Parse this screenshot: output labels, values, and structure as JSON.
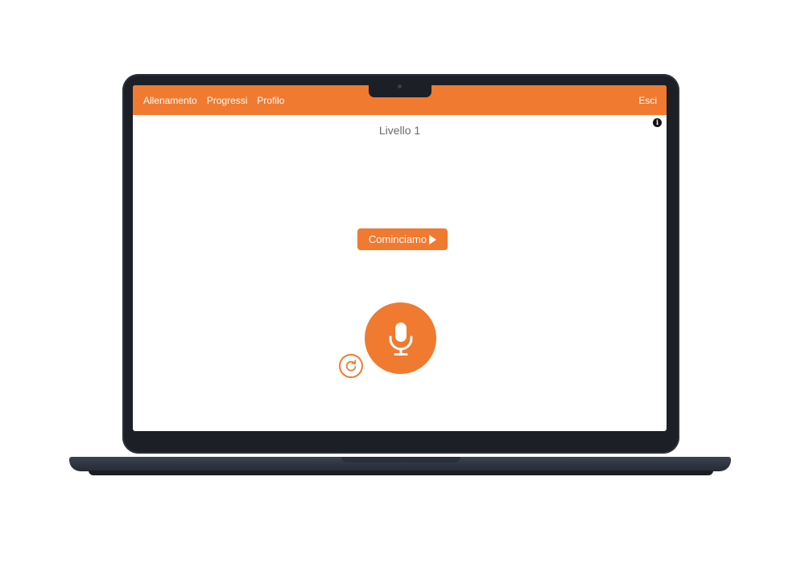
{
  "nav": {
    "links": [
      "Allenamento",
      "Progressi",
      "Profilo"
    ],
    "logout_label": "Esci"
  },
  "info_icon": {
    "glyph": "i",
    "icon": "info-icon"
  },
  "level": {
    "title": "Livello 1"
  },
  "start_button": {
    "label": "Cominciamo",
    "icon": "play-icon"
  },
  "mic_button": {
    "icon": "microphone-icon"
  },
  "retry_button": {
    "icon": "refresh-icon"
  },
  "colors": {
    "accent": "#f07a30",
    "title_text": "#6b6b6b",
    "device_frame": "#1c1f26"
  }
}
